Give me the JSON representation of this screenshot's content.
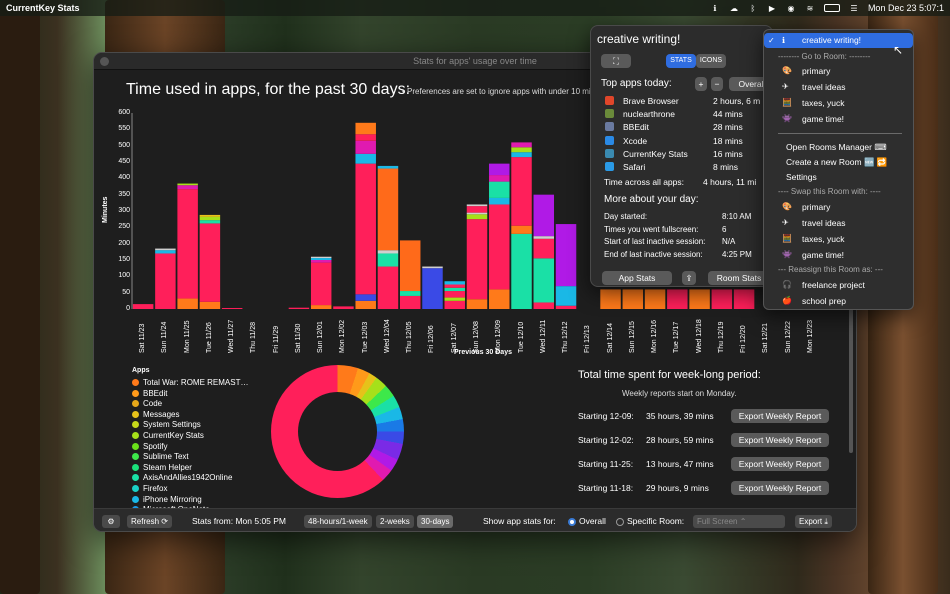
{
  "menubar": {
    "app_name": "CurrentKey Stats",
    "datetime": "Mon Dec 23  5:07:1"
  },
  "window": {
    "title": "Stats for apps' usage over time"
  },
  "chart_header": {
    "title": "Time used in apps, for the past 30 days:",
    "note": "• Preferences are set to ignore apps with under 10 minu"
  },
  "chart_data": {
    "type": "bar",
    "stacked": true,
    "xlabel": "Previous 30 Days",
    "ylabel": "Minutes",
    "ylim": [
      0,
      600
    ],
    "yticks": [
      "0",
      "50",
      "100",
      "150",
      "200",
      "250",
      "300",
      "350",
      "400",
      "450",
      "500",
      "550",
      "600"
    ],
    "categories": [
      "Sat 11/23",
      "Sun 11/24",
      "Mon 11/25",
      "Tue 11/26",
      "Wed 11/27",
      "Thu 11/28",
      "Fri 11/29",
      "Sat 11/30",
      "Sun 12/01",
      "Mon 12/02",
      "Tue 12/03",
      "Wed 12/04",
      "Thu 12/05",
      "Fri 12/06",
      "Sat 12/07",
      "Sun 12/08",
      "Mon 12/09",
      "Tue 12/10",
      "Wed 12/11",
      "Thu 12/12",
      "Fri 12/13",
      "Sat 12/14",
      "Sun 12/15",
      "Mon 12/16",
      "Tue 12/17",
      "Wed 12/18",
      "Thu 12/19",
      "Fri 12/20",
      "Sat 12/21",
      "Sun 12/22",
      "Mon 12/23"
    ],
    "stacks": [
      [
        {
          "c": "#ff1f5a",
          "v": 15
        }
      ],
      [
        {
          "c": "#ff1f5a",
          "v": 170
        },
        {
          "c": "#1ab8e6",
          "v": 10
        },
        {
          "c": "#cfcfcf",
          "v": 5
        }
      ],
      [
        {
          "c": "#ff7a1a",
          "v": 32
        },
        {
          "c": "#ff1f5a",
          "v": 335
        },
        {
          "c": "#e01ab0",
          "v": 12
        },
        {
          "c": "#a6e01a",
          "v": 5
        }
      ],
      [
        {
          "c": "#ff7a1a",
          "v": 22
        },
        {
          "c": "#ff1f5a",
          "v": 240
        },
        {
          "c": "#1ae0a6",
          "v": 10
        },
        {
          "c": "#a6e01a",
          "v": 10
        },
        {
          "c": "#e6c21a",
          "v": 6
        }
      ],
      [
        {
          "c": "#ff1f5a",
          "v": 3
        }
      ],
      [],
      [],
      [
        {
          "c": "#ff1f5a",
          "v": 4
        }
      ],
      [
        {
          "c": "#ff7a1a",
          "v": 12
        },
        {
          "c": "#ff1f5a",
          "v": 130
        },
        {
          "c": "#e01ab0",
          "v": 8
        },
        {
          "c": "#1ab8e6",
          "v": 6
        },
        {
          "c": "#cfcfcf",
          "v": 4
        }
      ],
      [
        {
          "c": "#ff1f5a",
          "v": 8
        }
      ],
      [
        {
          "c": "#ff7a1a",
          "v": 25
        },
        {
          "c": "#3a4ae6",
          "v": 20
        },
        {
          "c": "#ff1f5a",
          "v": 400
        },
        {
          "c": "#1ab8e6",
          "v": 30
        },
        {
          "c": "#e01ab0",
          "v": 40
        },
        {
          "c": "#ff1f5a",
          "v": 20
        },
        {
          "c": "#ff7a1a",
          "v": 35
        }
      ],
      [
        {
          "c": "#ff1f5a",
          "v": 130
        },
        {
          "c": "#1ae0a6",
          "v": 40
        },
        {
          "c": "#cfcfcf",
          "v": 10
        },
        {
          "c": "#ff6a1a",
          "v": 250
        },
        {
          "c": "#1ab8e6",
          "v": 8
        }
      ],
      [
        {
          "c": "#ff1f5a",
          "v": 40
        },
        {
          "c": "#1ae0a6",
          "v": 15
        },
        {
          "c": "#ff6a1a",
          "v": 155
        }
      ],
      [
        {
          "c": "#3a4ae6",
          "v": 125
        },
        {
          "c": "#cfcfcf",
          "v": 5
        }
      ],
      [
        {
          "c": "#ff1f5a",
          "v": 25
        },
        {
          "c": "#a6e01a",
          "v": 10
        },
        {
          "c": "#ff1f5a",
          "v": 20
        },
        {
          "c": "#1ae0a6",
          "v": 10
        },
        {
          "c": "#ff1f5a",
          "v": 10
        },
        {
          "c": "#1ab8e6",
          "v": 10
        }
      ],
      [
        {
          "c": "#ff7a1a",
          "v": 30
        },
        {
          "c": "#ff1f5a",
          "v": 245
        },
        {
          "c": "#a6e01a",
          "v": 15
        },
        {
          "c": "#cfcfcf",
          "v": 5
        },
        {
          "c": "#ff1f5a",
          "v": 20
        },
        {
          "c": "#cfcfcf",
          "v": 5
        }
      ],
      [
        {
          "c": "#ff7a1a",
          "v": 60
        },
        {
          "c": "#ff1f5a",
          "v": 260
        },
        {
          "c": "#1ab8e6",
          "v": 20
        },
        {
          "c": "#1ae0a6",
          "v": 50
        },
        {
          "c": "#e01ab0",
          "v": 20
        },
        {
          "c": "#b01ae6",
          "v": 35
        }
      ],
      [
        {
          "c": "#1ae0a6",
          "v": 230
        },
        {
          "c": "#ff7a1a",
          "v": 25
        },
        {
          "c": "#ff1f5a",
          "v": 210
        },
        {
          "c": "#1ab8e6",
          "v": 15
        },
        {
          "c": "#a6e01a",
          "v": 15
        },
        {
          "c": "#e01ab0",
          "v": 15
        }
      ],
      [
        {
          "c": "#ff1f5a",
          "v": 20
        },
        {
          "c": "#1ae0a6",
          "v": 135
        },
        {
          "c": "#ff1f5a",
          "v": 60
        },
        {
          "c": "#cfcfcf",
          "v": 8
        },
        {
          "c": "#b01ae6",
          "v": 127
        }
      ],
      [
        {
          "c": "#ff1f5a",
          "v": 10
        },
        {
          "c": "#1ab8e6",
          "v": 60
        },
        {
          "c": "#b01ae6",
          "v": 190
        }
      ],
      [],
      [
        {
          "c": "#ff7a1a",
          "v": 60
        }
      ],
      [
        {
          "c": "#ff7a1a",
          "v": 60
        }
      ],
      [
        {
          "c": "#ff7a1a",
          "v": 60
        }
      ],
      [
        {
          "c": "#ff1f5a",
          "v": 60
        }
      ],
      [
        {
          "c": "#ff7a1a",
          "v": 60
        }
      ],
      [
        {
          "c": "#ff1f5a",
          "v": 60
        }
      ],
      [
        {
          "c": "#ff1f5a",
          "v": 60
        }
      ],
      [],
      [],
      []
    ]
  },
  "legend": {
    "title": "Apps",
    "items": [
      {
        "label": "Total War: ROME REMAST…",
        "color": "#ff7a1a"
      },
      {
        "label": "BBEdit",
        "color": "#ff9a1a"
      },
      {
        "label": "Code",
        "color": "#e6a81a"
      },
      {
        "label": "Messages",
        "color": "#e6c21a"
      },
      {
        "label": "System Settings",
        "color": "#c6d81a"
      },
      {
        "label": "CurrentKey Stats",
        "color": "#a6e01a"
      },
      {
        "label": "Spotify",
        "color": "#6ae01a"
      },
      {
        "label": "Sublime Text",
        "color": "#3de84a"
      },
      {
        "label": "Steam Helper",
        "color": "#1ae07a"
      },
      {
        "label": "AxisAndAllies1942Online",
        "color": "#1ae0a6"
      },
      {
        "label": "Firefox",
        "color": "#1ad0c6"
      },
      {
        "label": "iPhone Mirroring",
        "color": "#1ab8e6"
      },
      {
        "label": "Microsoft OneNote",
        "color": "#1a9ae6"
      }
    ]
  },
  "weekly": {
    "title": "Total time spent for week-long period:",
    "subtitle": "Weekly reports start on Monday.",
    "export_label": "Export Weekly Report",
    "rows": [
      {
        "label": "Starting 12-09:",
        "value": "35 hours, 39 mins"
      },
      {
        "label": "Starting 12-02:",
        "value": "28 hours, 59 mins"
      },
      {
        "label": "Starting 11-25:",
        "value": "13 hours, 47 mins"
      },
      {
        "label": "Starting 11-18:",
        "value": "29 hours, 9 mins"
      }
    ]
  },
  "bottombar": {
    "refresh": "Refresh",
    "stats_from": "Stats from:  Mon 5:05 PM",
    "range_options": [
      "48-hours/1-week",
      "2-weeks",
      "30-days"
    ],
    "show_for": "Show app stats for:",
    "overall": "Overall",
    "specific_room": "Specific Room:",
    "room_select": "Full Screen",
    "export": "Export"
  },
  "popover": {
    "title": "creative writing!",
    "toggle_stats": "STATS",
    "toggle_icons": "ICONS",
    "top_apps_title": "Top apps today:",
    "overall_btn": "Overal",
    "apps": [
      {
        "name": "Brave Browser",
        "time": "2 hours, 6 m",
        "color": "#e0462a"
      },
      {
        "name": "nuclearthrone",
        "time": "44 mins",
        "color": "#6a8a3a"
      },
      {
        "name": "BBEdit",
        "time": "28 mins",
        "color": "#6a7aa0"
      },
      {
        "name": "Xcode",
        "time": "18 mins",
        "color": "#2a8ae6"
      },
      {
        "name": "CurrentKey Stats",
        "time": "16 mins",
        "color": "#3a8ab0"
      },
      {
        "name": "Safari",
        "time": "8 mins",
        "color": "#2a9ae6"
      }
    ],
    "across_label": "Time across all apps:",
    "across_value": "4 hours, 11 mi",
    "more_title": "More about your day:",
    "details": [
      {
        "label": "Day started:",
        "value": "8:10 AM"
      },
      {
        "label": "Times you went fullscreen:",
        "value": "6"
      },
      {
        "label": "Start of last inactive session:",
        "value": "N/A"
      },
      {
        "label": "End of last inactive session:",
        "value": "4:25 PM"
      }
    ],
    "app_stats_btn": "App Stats",
    "room_stats_btn": "Room Stats"
  },
  "room_menu": {
    "current": "creative writing!",
    "goto_header": "--------  Go to Room:  --------",
    "goto_rooms": [
      {
        "label": "primary",
        "icon": "🎨"
      },
      {
        "label": "travel ideas",
        "icon": "✈"
      },
      {
        "label": "taxes, yuck",
        "icon": "🧮"
      },
      {
        "label": "game time!",
        "icon": "👾"
      }
    ],
    "open_manager": "Open Rooms Manager  ⌨",
    "create_room": "Create a new Room  🆕  🔁",
    "settings": "Settings",
    "swap_header": "---- Swap this Room with: ----",
    "swap_rooms": [
      {
        "label": "primary",
        "icon": "🎨"
      },
      {
        "label": "travel ideas",
        "icon": "✈"
      },
      {
        "label": "taxes, yuck",
        "icon": "🧮"
      },
      {
        "label": "game time!",
        "icon": "👾"
      }
    ],
    "reassign_header": "--- Reassign this Room as: ---",
    "reassign": [
      {
        "label": "freelance project",
        "icon": "🎧"
      },
      {
        "label": "school prep",
        "icon": "🍎"
      }
    ]
  }
}
